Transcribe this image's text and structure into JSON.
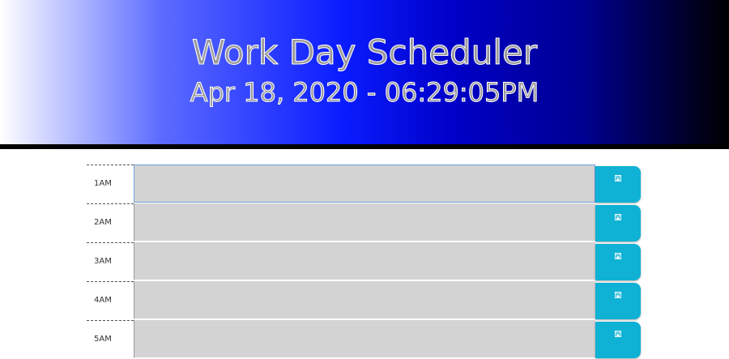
{
  "header": {
    "title": "Work Day Scheduler",
    "datetime": "Apr 18, 2020 - 06:29:05PM"
  },
  "schedule": {
    "rows": [
      {
        "hour": "1AM",
        "text": "",
        "save_icon": "floppy-disk-icon"
      },
      {
        "hour": "2AM",
        "text": "",
        "save_icon": "floppy-disk-icon"
      },
      {
        "hour": "3AM",
        "text": "",
        "save_icon": "floppy-disk-icon"
      },
      {
        "hour": "4AM",
        "text": "",
        "save_icon": "floppy-disk-icon"
      },
      {
        "hour": "5AM",
        "text": "",
        "save_icon": "floppy-disk-icon"
      }
    ]
  },
  "colors": {
    "past_block": "#d3d3d3",
    "save_button": "#0fb1d4",
    "divider": "#000000"
  }
}
